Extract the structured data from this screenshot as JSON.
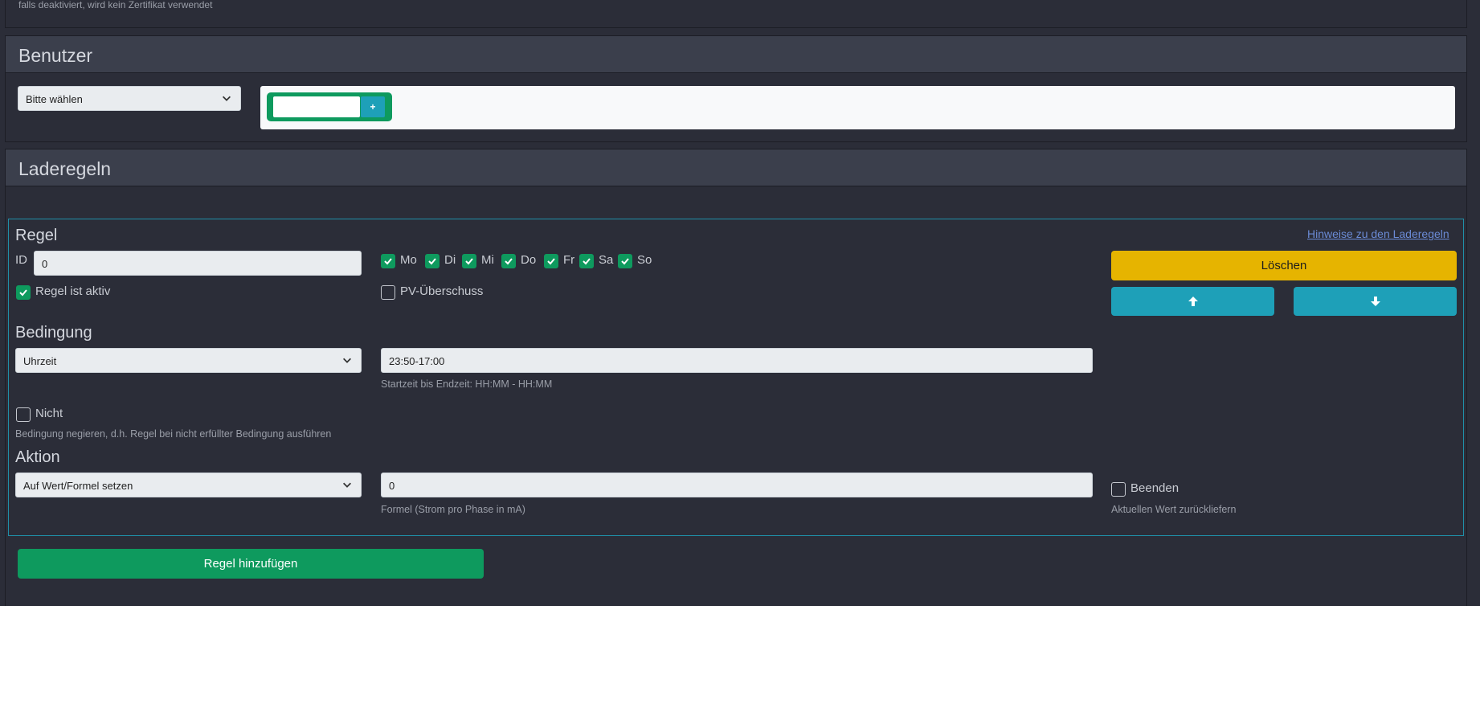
{
  "top_hint": "falls deaktiviert, wird kein Zertifikat verwendet",
  "benutzer": {
    "title": "Benutzer",
    "select_value": "Bitte wählen",
    "add_label": "+"
  },
  "laderegeln": {
    "title": "Laderegeln",
    "regel": {
      "title": "Regel",
      "hint_link": "Hinweise zu den Laderegeln",
      "id_label": "ID",
      "id_value": "0",
      "active_label": "Regel ist aktiv",
      "days": [
        {
          "label": "Mo",
          "checked": true
        },
        {
          "label": "Di",
          "checked": true
        },
        {
          "label": "Mi",
          "checked": true
        },
        {
          "label": "Do",
          "checked": true
        },
        {
          "label": "Fr",
          "checked": true
        },
        {
          "label": "Sa",
          "checked": true
        },
        {
          "label": "So",
          "checked": true
        }
      ],
      "pv_label": "PV-Überschuss",
      "delete_label": "Löschen",
      "up_icon": "arrow-up-icon",
      "down_icon": "arrow-down-icon"
    },
    "bedingung": {
      "title": "Bedingung",
      "select_value": "Uhrzeit",
      "time_value": "23:50-17:00",
      "time_hint": "Startzeit bis Endzeit: HH:MM - HH:MM",
      "not_label": "Nicht",
      "not_hint": "Bedingung negieren, d.h. Regel bei nicht erfüllter Bedingung ausführen"
    },
    "aktion": {
      "title": "Aktion",
      "select_value": "Auf Wert/Formel setzen",
      "formula_value": "0",
      "formula_hint": "Formel (Strom pro Phase in mA)",
      "end_label": "Beenden",
      "end_hint": "Aktuellen Wert zurückliefern"
    },
    "add_rule_label": "Regel hinzufügen"
  },
  "colors": {
    "background": "#2b2d38",
    "header": "#3b3f4c",
    "success": "#0e9a5e",
    "info": "#1ea0b8",
    "warning": "#e6b400",
    "link": "#6b8bd6"
  }
}
